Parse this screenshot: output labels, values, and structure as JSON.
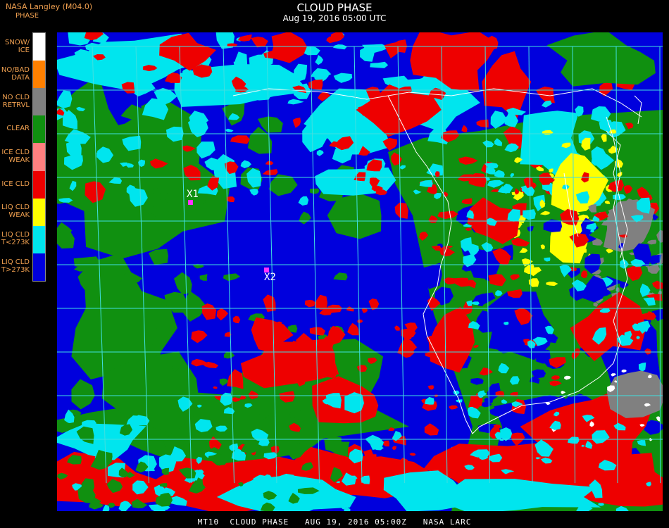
{
  "header": {
    "source": "NASA Langley (M04.0)",
    "legend_title": "PHASE",
    "title": "CLOUD PHASE",
    "subtitle": "Aug 19, 2016 05:00 UTC"
  },
  "legend": [
    {
      "label": "SNOW/\nICE",
      "color": "#ffffff"
    },
    {
      "label": "NO/BAD\nDATA",
      "color": "#ff8000"
    },
    {
      "label": "NO CLD\nRETRVL",
      "color": "#808080"
    },
    {
      "label": "CLEAR",
      "color": "#109010"
    },
    {
      "label": "ICE CLD\nWEAK",
      "color": "#ff8080"
    },
    {
      "label": "ICE CLD",
      "color": "#ee0000"
    },
    {
      "label": "LIQ CLD\nWEAK",
      "color": "#ffff00"
    },
    {
      "label": "LIQ CLD\nT<273K",
      "color": "#00e5ee"
    },
    {
      "label": "LIQ CLD\nT>273K",
      "color": "#0000dd"
    }
  ],
  "markers": [
    {
      "label": "X1"
    },
    {
      "label": "X2"
    }
  ],
  "colors": {
    "grid": "#40e0e0",
    "coast": "#ffffff",
    "marker": "#ff33ff"
  },
  "footer": "MT10  CLOUD PHASE   AUG 19, 2016 05:00Z   NASA LARC"
}
